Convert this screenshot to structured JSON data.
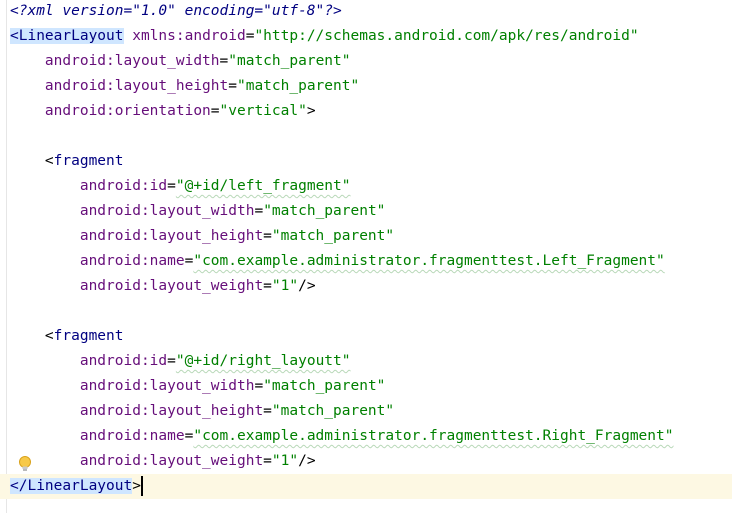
{
  "editor": {
    "lines": [
      {
        "indent": "",
        "parts": [
          [
            "decl",
            "<?xml version=\"1.0\" encoding=\"utf-8\"?>"
          ]
        ]
      },
      {
        "indent": "",
        "parts": [
          [
            "tagopen-hl",
            "<LinearLayout"
          ],
          [
            "attr",
            " xmlns:android"
          ],
          [
            "plain",
            "="
          ],
          [
            "val",
            "\"http://schemas.android.com/apk/res/android\""
          ]
        ]
      },
      {
        "indent": "    ",
        "parts": [
          [
            "attr",
            "android:layout_width"
          ],
          [
            "plain",
            "="
          ],
          [
            "val",
            "\"match_parent\""
          ]
        ]
      },
      {
        "indent": "    ",
        "parts": [
          [
            "attr",
            "android:layout_height"
          ],
          [
            "plain",
            "="
          ],
          [
            "val",
            "\"match_parent\""
          ]
        ]
      },
      {
        "indent": "    ",
        "parts": [
          [
            "attr",
            "android:orientation"
          ],
          [
            "plain",
            "="
          ],
          [
            "val",
            "\"vertical\""
          ],
          [
            "plain",
            ">"
          ]
        ]
      },
      {
        "indent": "",
        "parts": []
      },
      {
        "indent": "    ",
        "parts": [
          [
            "plain",
            "<"
          ],
          [
            "tag",
            "fragment"
          ]
        ]
      },
      {
        "indent": "        ",
        "parts": [
          [
            "attr",
            "android:id"
          ],
          [
            "plain",
            "="
          ],
          [
            "val",
            "\"@+id/left_fragment\""
          ]
        ]
      },
      {
        "indent": "        ",
        "parts": [
          [
            "attr",
            "android:layout_width"
          ],
          [
            "plain",
            "="
          ],
          [
            "val",
            "\"match_parent\""
          ]
        ]
      },
      {
        "indent": "        ",
        "parts": [
          [
            "attr",
            "android:layout_height"
          ],
          [
            "plain",
            "="
          ],
          [
            "val",
            "\"match_parent\""
          ]
        ]
      },
      {
        "indent": "        ",
        "parts": [
          [
            "attr",
            "android:name"
          ],
          [
            "plain",
            "="
          ],
          [
            "val",
            "\"com.example.administrator.fragmenttest.Left_Fragment\""
          ]
        ]
      },
      {
        "indent": "        ",
        "parts": [
          [
            "attr",
            "android:layout_weight"
          ],
          [
            "plain",
            "="
          ],
          [
            "val",
            "\"1\""
          ],
          [
            "plain",
            "/>"
          ]
        ]
      },
      {
        "indent": "",
        "parts": []
      },
      {
        "indent": "    ",
        "parts": [
          [
            "plain",
            "<"
          ],
          [
            "tag",
            "fragment"
          ]
        ]
      },
      {
        "indent": "        ",
        "parts": [
          [
            "attr",
            "android:id"
          ],
          [
            "plain",
            "="
          ],
          [
            "val",
            "\"@+id/right_layoutt\""
          ]
        ]
      },
      {
        "indent": "        ",
        "parts": [
          [
            "attr",
            "android:layout_width"
          ],
          [
            "plain",
            "="
          ],
          [
            "val",
            "\"match_parent\""
          ]
        ]
      },
      {
        "indent": "        ",
        "parts": [
          [
            "attr",
            "android:layout_height"
          ],
          [
            "plain",
            "="
          ],
          [
            "val",
            "\"match_parent\""
          ]
        ]
      },
      {
        "indent": "        ",
        "parts": [
          [
            "attr",
            "android:name"
          ],
          [
            "plain",
            "="
          ],
          [
            "val",
            "\"com.example.administrator.fragmenttest.Right_Fragment\""
          ]
        ]
      },
      {
        "indent": "        ",
        "parts": [
          [
            "attr",
            "android:layout_weight"
          ],
          [
            "plain",
            "="
          ],
          [
            "val",
            "\"1\""
          ],
          [
            "plain",
            "/>"
          ]
        ]
      },
      {
        "indent": "",
        "parts": [
          [
            "tagclose-hl",
            "</LinearLayout"
          ],
          [
            "plain",
            ">"
          ],
          [
            "caret",
            ""
          ]
        ]
      }
    ],
    "colors": {
      "tag": "#000080",
      "attribute": "#660e7a",
      "value": "#008000",
      "tag_highlight": "#cfe6ff",
      "caret_row": "#fdf8e3"
    },
    "gutter_icons": [
      "lightbulb-icon"
    ]
  }
}
